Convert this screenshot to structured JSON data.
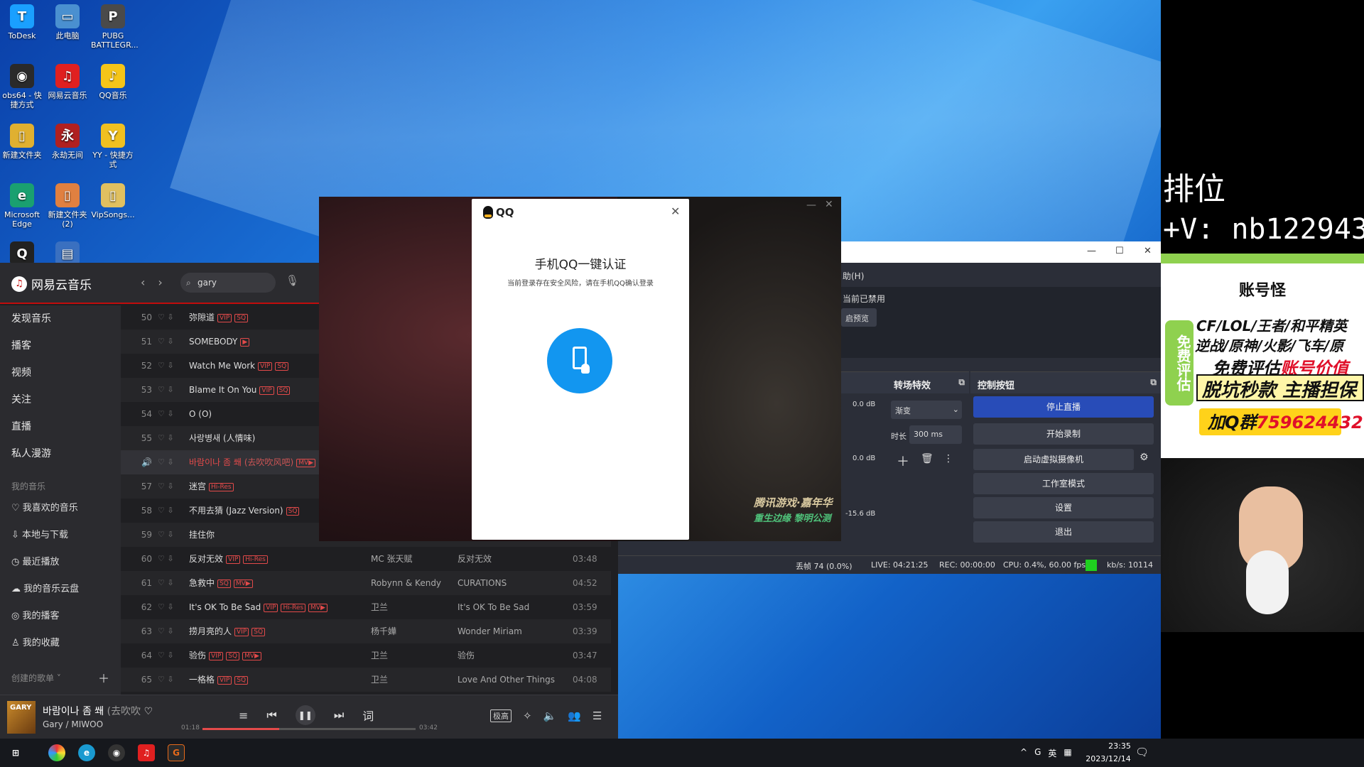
{
  "desktop": {
    "icons": [
      {
        "label": "ToDesk",
        "glyph": "T",
        "color": "#1aa0ff"
      },
      {
        "label": "此电脑",
        "glyph": "▭",
        "color": "#4a90d0"
      },
      {
        "label": "PUBG BATTLEGR...",
        "glyph": "P",
        "color": "#4a4a4a"
      },
      {
        "label": "obs64 - 快捷方式",
        "glyph": "◉",
        "color": "#2a2a2a"
      },
      {
        "label": "网易云音乐",
        "glyph": "♫",
        "color": "#e02020"
      },
      {
        "label": "QQ音乐",
        "glyph": "♪",
        "color": "#f5c518"
      },
      {
        "label": "新建文件夹",
        "glyph": "▯",
        "color": "#e0b030"
      },
      {
        "label": "永劫无间",
        "glyph": "永",
        "color": "#b02020"
      },
      {
        "label": "YY - 快捷方式",
        "glyph": "Y",
        "color": "#f0c020"
      },
      {
        "label": "Microsoft Edge",
        "glyph": "e",
        "color": "#1aa070"
      },
      {
        "label": "新建文件夹 (2)",
        "glyph": "▯",
        "color": "#e08040"
      },
      {
        "label": "VipSongs...",
        "glyph": "▯",
        "color": "#e0c060"
      },
      {
        "label": "",
        "glyph": "Q",
        "color": "#222"
      },
      {
        "label": "",
        "glyph": "▤",
        "color": "#3a70c0"
      }
    ]
  },
  "stream_overlay": {
    "title": "排位",
    "wechat": "+V: nb122943",
    "ad": {
      "brand": "账号怪",
      "side": "免费评估",
      "line1": "CF/LOL/王者/和平精英",
      "line2": "逆战/原神/火影/飞车/原",
      "line3_prefix": "免费评估",
      "line3_red": "账号价值",
      "line4": "脱坑秒款 主播担保",
      "line5_prefix": "加Q群",
      "line5_red": "759624432"
    }
  },
  "netease": {
    "app_name": "网易云音乐",
    "search_value": "gary",
    "sidebar": {
      "items": [
        "发现音乐",
        "播客",
        "视频",
        "关注",
        "直播",
        "私人漫游"
      ],
      "my_music_title": "我的音乐",
      "my_music": [
        "我喜欢的音乐",
        "本地与下载",
        "最近播放",
        "我的音乐云盘",
        "我的播客",
        "我的收藏"
      ],
      "created_title": "创建的歌单 ˅"
    },
    "tracks": [
      {
        "num": "50",
        "title": "弥隙道",
        "sub": "",
        "tags": [
          "VIP",
          "SQ"
        ],
        "artist": "",
        "album": "",
        "duration": ""
      },
      {
        "num": "51",
        "title": "SOMEBODY",
        "sub": "",
        "tags": [
          "▶"
        ],
        "artist": "",
        "album": "",
        "duration": ""
      },
      {
        "num": "52",
        "title": "Watch Me Work",
        "sub": "",
        "tags": [
          "VIP",
          "SQ"
        ],
        "artist": "",
        "album": "",
        "duration": ""
      },
      {
        "num": "53",
        "title": "Blame It On You",
        "sub": "",
        "tags": [
          "VIP",
          "SQ"
        ],
        "artist": "",
        "album": "",
        "duration": ""
      },
      {
        "num": "54",
        "title": "O (O)",
        "sub": "",
        "tags": [],
        "artist": "",
        "album": "",
        "duration": ""
      },
      {
        "num": "55",
        "title": "사랑병새 (人情味)",
        "sub": "",
        "tags": [],
        "artist": "",
        "album": "",
        "duration": ""
      },
      {
        "num": "",
        "title": "바람이나 좀 쐐",
        "sub": "(去吹吹风吧)",
        "tags": [
          "MV▶"
        ],
        "artist": "",
        "album": "",
        "duration": ""
      },
      {
        "num": "57",
        "title": "迷宫",
        "sub": "",
        "tags": [
          "Hi-Res"
        ],
        "artist": "",
        "album": "",
        "duration": ""
      },
      {
        "num": "58",
        "title": "不用去猜 (Jazz Version)",
        "sub": "",
        "tags": [
          "SQ"
        ],
        "artist": "",
        "album": "",
        "duration": ""
      },
      {
        "num": "59",
        "title": "挂住你",
        "sub": "",
        "tags": [],
        "artist": "",
        "album": "",
        "duration": ""
      },
      {
        "num": "60",
        "title": "反对无效",
        "sub": "",
        "tags": [
          "VIP",
          "Hi-Res"
        ],
        "artist": "MC 张天赋",
        "album": "反对无效",
        "duration": "03:48"
      },
      {
        "num": "61",
        "title": "急救中",
        "sub": "",
        "tags": [
          "SQ",
          "MV▶"
        ],
        "artist": "Robynn & Kendy",
        "album": "CURATIONS",
        "duration": "04:52"
      },
      {
        "num": "62",
        "title": "It's OK To Be Sad",
        "sub": "",
        "tags": [
          "VIP",
          "Hi-Res",
          "MV▶"
        ],
        "artist": "卫兰",
        "album": "It's OK To Be Sad",
        "duration": "03:59"
      },
      {
        "num": "63",
        "title": "捞月亮的人",
        "sub": "",
        "tags": [
          "VIP",
          "SQ"
        ],
        "artist": "杨千嬅",
        "album": "Wonder Miriam",
        "duration": "03:39"
      },
      {
        "num": "64",
        "title": "验伤",
        "sub": "",
        "tags": [
          "VIP",
          "SQ",
          "MV▶"
        ],
        "artist": "卫兰",
        "album": "验伤",
        "duration": "03:47"
      },
      {
        "num": "65",
        "title": "一格格",
        "sub": "",
        "tags": [
          "VIP",
          "SQ"
        ],
        "artist": "卫兰",
        "album": "Love And Other Things",
        "duration": "04:08"
      }
    ],
    "player": {
      "cover_text": "GARY",
      "song": "바람이나 좀 쐐",
      "song_sub": "(去吹吹",
      "artist": "Gary / MIWOO",
      "elapsed": "01:18",
      "total": "03:42",
      "progress": 0.36,
      "lyric": "词",
      "quality": "极高"
    }
  },
  "qq_dialog": {
    "logo": "QQ",
    "heading": "手机QQ一键认证",
    "subtext": "当前登录存在安全风险，请在手机QQ确认登录"
  },
  "video": {
    "watermark1": "腾讯游戏·嘉年华",
    "watermark2": "重生边缘 黎明公测"
  },
  "obs": {
    "menu_help": "助(H)",
    "warn": "当前已禁用",
    "preview_btn": "启预览",
    "meters": [
      "0.0 dB",
      "0.0 dB",
      "-15.6 dB"
    ],
    "transitions": {
      "title": "转场特效",
      "select": "渐变",
      "duration_label": "时长",
      "duration_value": "300 ms"
    },
    "controls": {
      "title": "控制按钮",
      "buttons": [
        "停止直播",
        "开始录制",
        "启动虚拟摄像机",
        "工作室模式",
        "设置",
        "退出"
      ]
    },
    "status": {
      "dropped": "丢帧 74 (0.0%)",
      "live": "LIVE: 04:21:25",
      "rec": "REC: 00:00:00",
      "cpu": "CPU: 0.4%, 60.00 fps",
      "kbs": "kb/s: 10114"
    }
  },
  "taskbar": {
    "tray_ime": "英",
    "time": "23:35",
    "date": "2023/12/14"
  }
}
